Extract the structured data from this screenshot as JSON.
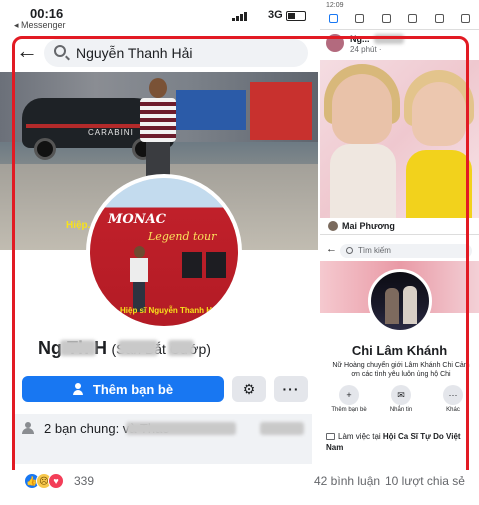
{
  "status_bar": {
    "time": "00:16",
    "back_app": "◂ Messenger",
    "network": "3G"
  },
  "search": {
    "query": "Nguyễn Thanh Hải"
  },
  "cover": {
    "car_text": "CARABINI",
    "watermark": "Hiệp..."
  },
  "avatar": {
    "bus_text": "MONAC",
    "bus_text2": "Legend tour",
    "caption": "Hiệp sĩ Nguyễn Thanh H..."
  },
  "profile": {
    "name_visible": "Ng    Th      H",
    "alias": "(Săn Bắt Cướp)",
    "add_friend_label": "Thêm bạn bè",
    "more_label": "···"
  },
  "mutual": {
    "text": "2 bạn chung:                        và                Thao"
  },
  "right_post": {
    "poster_name": "Ng...",
    "post_time": "24 phút ·",
    "commenter_name": "Mai Phương"
  },
  "nested_profile": {
    "status_time": "12:09",
    "search_placeholder": "Tìm kiếm",
    "name": "Chi Lâm Khánh",
    "bio": "Nữ Hoàng chuyển giới Lâm Khánh Chi Cảm ơn các tình yêu luôn ủng hộ Chi",
    "actions": [
      {
        "label": "Thêm bạn bè",
        "icon": "+"
      },
      {
        "label": "Nhắn tin",
        "icon": "✉"
      },
      {
        "label": "Khác",
        "icon": "···"
      }
    ],
    "work_prefix": "Làm việc tại ",
    "work_place": "Hội Ca Sĩ Tự Do Việt Nam"
  },
  "reactions": {
    "count": "339",
    "comments": "42 bình luận",
    "shares": "10 lượt chia sẻ"
  },
  "colors": {
    "highlight": "#e21a23",
    "fb_blue": "#1877f2"
  }
}
